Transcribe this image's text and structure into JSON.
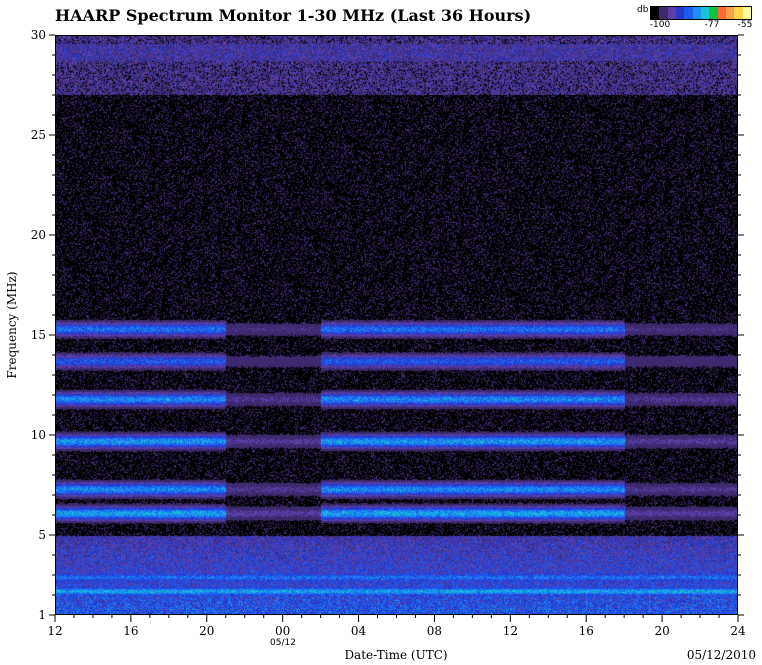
{
  "chart_data": {
    "type": "heatmap",
    "title": "HAARP Spectrum Monitor 1-30 MHz (Last 36 Hours)",
    "xlabel": "Date-Time (UTC)",
    "ylabel": "Frequency (MHz)",
    "date_label": "05/12/2010",
    "day_marker": "05/12",
    "x_tick_labels": [
      "12",
      "16",
      "20",
      "00",
      "04",
      "08",
      "12",
      "16",
      "20",
      "24"
    ],
    "y_ticks": [
      1,
      5,
      10,
      15,
      20,
      25,
      30
    ],
    "ylim": [
      1,
      30
    ],
    "x_hours_range": [
      0,
      36
    ],
    "colorbar": {
      "unit": "db",
      "labels": [
        "-100",
        "-77",
        "-55"
      ],
      "range": [
        -100,
        -55
      ],
      "colors": [
        "#000000",
        "#3d2a6e",
        "#5a3fa8",
        "#2838c8",
        "#1e5cf0",
        "#1c8ff0",
        "#15c4d8",
        "#15c03a",
        "#ff6a3a",
        "#ff9f4a",
        "#ffd84a",
        "#ffff9a"
      ]
    },
    "bands_mhz": [
      {
        "center": 15.3,
        "level_db": -82
      },
      {
        "center": 13.7,
        "level_db": -84
      },
      {
        "center": 11.8,
        "level_db": -80
      },
      {
        "center": 9.7,
        "level_db": -79
      },
      {
        "center": 7.3,
        "level_db": -80
      },
      {
        "center": 6.1,
        "level_db": -78
      },
      {
        "center": 2.9,
        "level_db": -82
      },
      {
        "center": 2.2,
        "level_db": -78
      }
    ]
  }
}
